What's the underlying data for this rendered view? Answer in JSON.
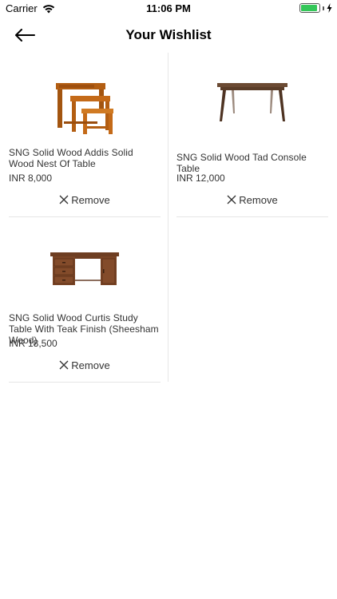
{
  "status_bar": {
    "carrier": "Carrier",
    "time": "11:06 PM",
    "battery_level": 0.9,
    "battery_color": "#34c759"
  },
  "header": {
    "title": "Your Wishlist",
    "back_icon": "arrow-left-icon"
  },
  "items": [
    {
      "name": "SNG Solid Wood Addis Solid Wood Nest Of Table",
      "price": "INR 8,000",
      "remove_label": "Remove",
      "image": "nest-of-tables"
    },
    {
      "name": "SNG Solid Wood Tad Console Table",
      "price": "INR 12,000",
      "remove_label": "Remove",
      "image": "console-table"
    },
    {
      "name": "SNG Solid Wood Curtis Study Table With Teak Finish (Sheesham Wood)",
      "price": "INR 18,500",
      "remove_label": "Remove",
      "image": "study-table"
    }
  ]
}
